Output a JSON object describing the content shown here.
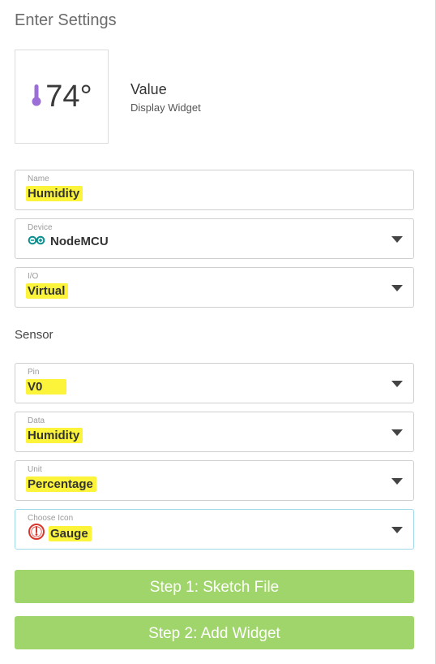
{
  "page": {
    "heading": "Enter Settings"
  },
  "preview": {
    "value": "74°",
    "widget_title": "Value",
    "widget_subtitle": "Display Widget",
    "thermometer_color": "#9b6fd6"
  },
  "fields": {
    "name": {
      "label": "Name",
      "value": "Humidity"
    },
    "device": {
      "label": "Device",
      "value": "NodeMCU",
      "icon": "arduino-icon"
    },
    "io": {
      "label": "I/O",
      "value": "Virtual"
    },
    "pin": {
      "label": "Pin",
      "value": "V0"
    },
    "data": {
      "label": "Data",
      "value": "Humidity"
    },
    "unit": {
      "label": "Unit",
      "value": "Percentage"
    },
    "icon": {
      "label": "Choose Icon",
      "value": "Gauge",
      "icon": "gauge-icon"
    }
  },
  "sensor_section": {
    "label": "Sensor"
  },
  "buttons": {
    "step1": "Step 1: Sketch File",
    "step2": "Step 2: Add Widget"
  },
  "colors": {
    "button_green": "#9fd56a",
    "highlight": "#fbf43a",
    "focus_border": "#9fd9ea",
    "arduino_teal": "#0a8f8f",
    "gauge_red": "#d9362b"
  }
}
